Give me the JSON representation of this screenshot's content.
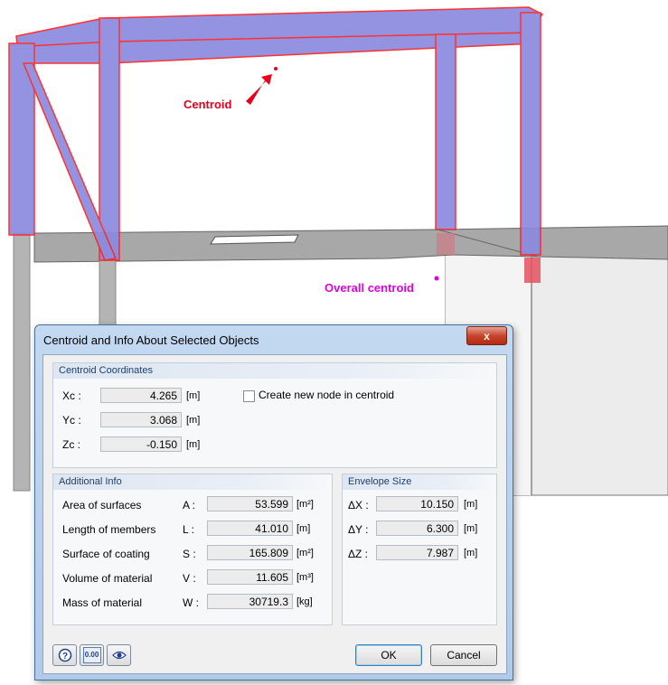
{
  "scene": {
    "centroid_label": "Centroid",
    "overall_centroid_label": "Overall centroid",
    "colors": {
      "member_fill": "#8a8ae0",
      "member_outline": "#ff2020",
      "centroid_red": "#e8001c",
      "overall_magenta": "#e000e0",
      "slab_gray": "#a9a9a9"
    }
  },
  "dialog": {
    "title": "Centroid and Info About Selected Objects",
    "close_glyph": "x",
    "centroid": {
      "header": "Centroid Coordinates",
      "xc_label": "Xc :",
      "xc_value": "4.265",
      "xc_unit": "[m]",
      "yc_label": "Yc :",
      "yc_value": "3.068",
      "yc_unit": "[m]",
      "zc_label": "Zc :",
      "zc_value": "-0.150",
      "zc_unit": "[m]",
      "create_node_label": "Create new node in centroid",
      "create_node_checked": false
    },
    "additional": {
      "header": "Additional Info",
      "rows": [
        {
          "label": "Area of surfaces",
          "symbol": "A :",
          "value": "53.599",
          "unit": "[m²]"
        },
        {
          "label": "Length of members",
          "symbol": "L :",
          "value": "41.010",
          "unit": "[m]"
        },
        {
          "label": "Surface of coating",
          "symbol": "S :",
          "value": "165.809",
          "unit": "[m²]"
        },
        {
          "label": "Volume of material",
          "symbol": "V :",
          "value": "11.605",
          "unit": "[m³]"
        },
        {
          "label": "Mass of material",
          "symbol": "W :",
          "value": "30719.3",
          "unit": "[kg]"
        }
      ]
    },
    "envelope": {
      "header": "Envelope Size",
      "rows": [
        {
          "symbol": "ΔX :",
          "value": "10.150",
          "unit": "[m]"
        },
        {
          "symbol": "ΔY :",
          "value": "6.300",
          "unit": "[m]"
        },
        {
          "symbol": "ΔZ :",
          "value": "7.987",
          "unit": "[m]"
        }
      ]
    },
    "footer": {
      "help_icon": "help-icon",
      "decimals_icon": "decimal-places-icon",
      "decimals_text": "0.00",
      "view_icon": "eye-icon",
      "ok_label": "OK",
      "cancel_label": "Cancel"
    }
  }
}
